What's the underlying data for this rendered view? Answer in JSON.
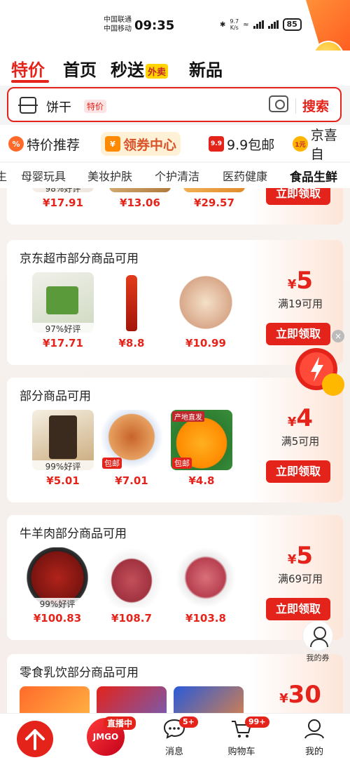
{
  "status_bar": {
    "carrier1": "中国联通",
    "carrier2": "中国移动",
    "time": "09:35",
    "speed_value": "9.7",
    "speed_unit": "K/s",
    "battery": "85"
  },
  "nav": {
    "tabs": [
      {
        "label": "特价"
      },
      {
        "label": "首页"
      },
      {
        "label": "秒送"
      },
      {
        "label": "新品"
      }
    ],
    "waimai_tag": "外卖"
  },
  "search": {
    "query": "饼干",
    "badge": "特价",
    "button": "搜索"
  },
  "chips": [
    {
      "label": "特价推荐",
      "icon": "%"
    },
    {
      "label": "领券中心",
      "icon": "¥"
    },
    {
      "label": "9.9包邮",
      "icon": "9.9"
    },
    {
      "label": "京喜自",
      "icon": "1元"
    }
  ],
  "subcategories": [
    "母婴玩具",
    "美妆护肤",
    "个护清洁",
    "医药健康",
    "食品生鲜"
  ],
  "coupons": [
    {
      "title": "",
      "products": [
        {
          "rating": "98%好评",
          "price": "¥17.91"
        },
        {
          "rating": "",
          "price": "¥13.06"
        },
        {
          "rating": "",
          "price": "¥29.57"
        }
      ],
      "claim": "立即领取"
    },
    {
      "title": "京东超市部分商品可用",
      "amount": "5",
      "condition": "满19可用",
      "products": [
        {
          "rating": "97%好评",
          "price": "¥17.71"
        },
        {
          "rating": "",
          "price": "¥8.8"
        },
        {
          "rating": "",
          "price": "¥10.99"
        }
      ],
      "claim": "立即领取"
    },
    {
      "title": "部分商品可用",
      "amount": "4",
      "condition": "满5可用",
      "products": [
        {
          "rating": "99%好评",
          "price": "¥5.01"
        },
        {
          "rating": "",
          "price": "¥7.01",
          "badge": "包邮"
        },
        {
          "rating": "",
          "price": "¥4.8",
          "badge": "包邮",
          "origin": "产地直发"
        }
      ],
      "claim": "立即领取"
    },
    {
      "title": "牛羊肉部分商品可用",
      "amount": "5",
      "condition": "满69可用",
      "products": [
        {
          "rating": "99%好评",
          "price": "¥100.83"
        },
        {
          "rating": "",
          "price": "¥108.7"
        },
        {
          "rating": "",
          "price": "¥103.8"
        }
      ],
      "claim": "立即领取"
    },
    {
      "title": "零食乳饮部分商品可用",
      "amount": "30"
    }
  ],
  "currency": "¥",
  "my_coupon": "我的券",
  "bottom": {
    "live_tag": "直播中",
    "live_logo": "JMGO",
    "messages": "消息",
    "messages_badge": "5+",
    "cart": "购物车",
    "cart_badge": "99+",
    "me": "我的"
  }
}
